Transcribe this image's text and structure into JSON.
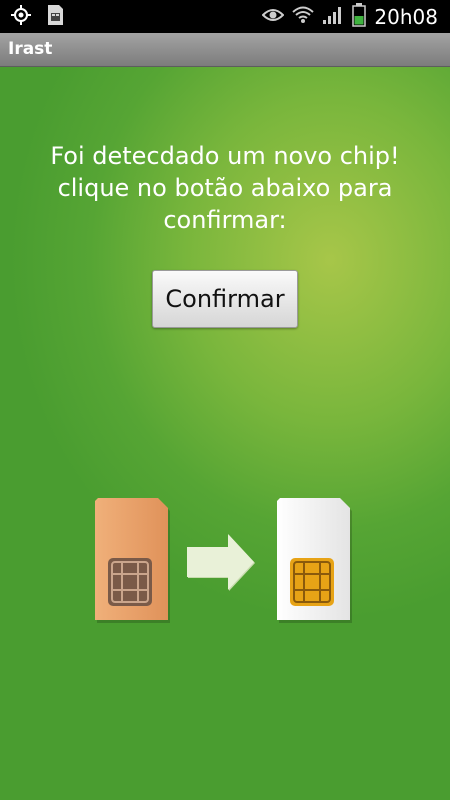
{
  "status_bar": {
    "time": "20h08",
    "icons": [
      "gps-icon",
      "sd-card-icon",
      "eye-icon",
      "wifi-icon",
      "signal-icon",
      "battery-icon"
    ]
  },
  "app": {
    "title": "Irast"
  },
  "message": {
    "lines": [
      "Foi detecdado um novo chip!",
      "clique no botão abaixo para",
      "confirmar:"
    ]
  },
  "confirm_button": {
    "label": "Confirmar"
  },
  "illustration": {
    "old_sim_color": "#e9a06b",
    "new_sim_color": "#f5f5f5",
    "old_chip_color": "#7a5a48",
    "new_chip_color": "#e7a316",
    "arrow_color": "#e9f1d8"
  }
}
